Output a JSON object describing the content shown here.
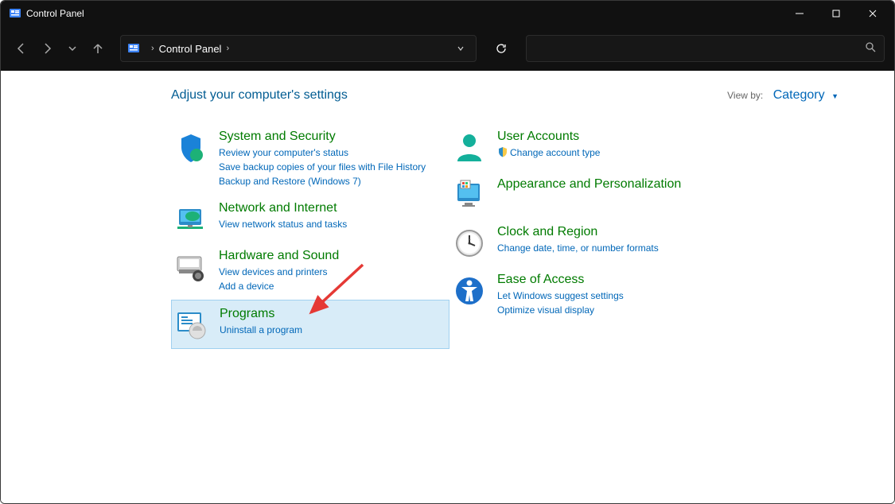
{
  "window": {
    "title": "Control Panel"
  },
  "address": {
    "root": "Control Panel"
  },
  "header": {
    "title": "Adjust your computer's settings",
    "view_by_label": "View by:",
    "view_by_value": "Category"
  },
  "col1": [
    {
      "key": "system-security",
      "title": "System and Security",
      "links": [
        "Review your computer's status",
        "Save backup copies of your files with File History",
        "Backup and Restore (Windows 7)"
      ]
    },
    {
      "key": "network-internet",
      "title": "Network and Internet",
      "links": [
        "View network status and tasks"
      ]
    },
    {
      "key": "hardware-sound",
      "title": "Hardware and Sound",
      "links": [
        "View devices and printers",
        "Add a device"
      ]
    },
    {
      "key": "programs",
      "title": "Programs",
      "links": [
        "Uninstall a program"
      ],
      "highlighted": true
    }
  ],
  "col2": [
    {
      "key": "user-accounts",
      "title": "User Accounts",
      "links": [
        "Change account type"
      ],
      "shielded": [
        0
      ]
    },
    {
      "key": "appearance-personalization",
      "title": "Appearance and Personalization",
      "links": []
    },
    {
      "key": "clock-region",
      "title": "Clock and Region",
      "links": [
        "Change date, time, or number formats"
      ]
    },
    {
      "key": "ease-of-access",
      "title": "Ease of Access",
      "links": [
        "Let Windows suggest settings",
        "Optimize visual display"
      ]
    }
  ]
}
